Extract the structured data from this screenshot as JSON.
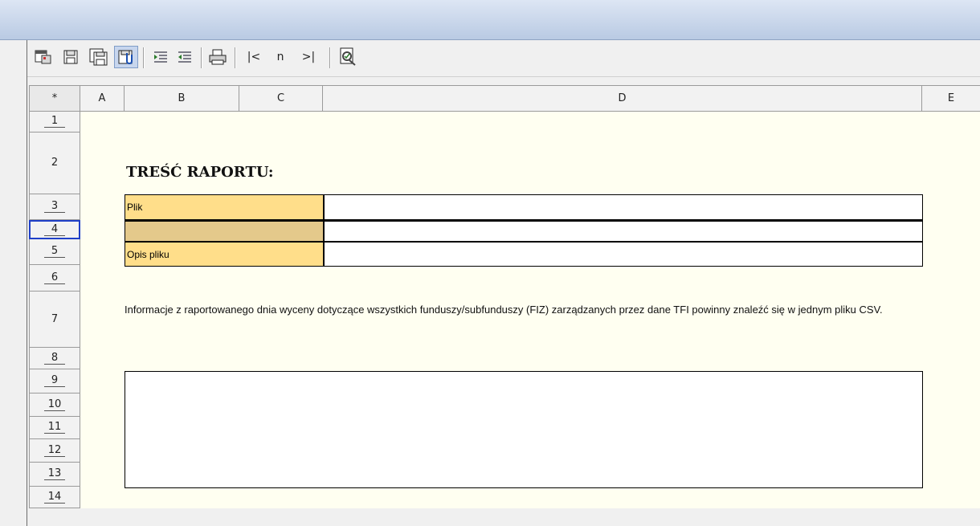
{
  "toolbar": {
    "nav_first": "|<",
    "nav_n": "n",
    "nav_last": ">|"
  },
  "columns": [
    "*",
    "A",
    "B",
    "C",
    "D",
    "E"
  ],
  "rows": [
    "1",
    "2",
    "3",
    "4",
    "5",
    "6",
    "7",
    "8",
    "9",
    "10",
    "11",
    "12",
    "13",
    "14"
  ],
  "form": {
    "title": "TREŚĆ RAPORTU:",
    "plik_label": "Plik",
    "plik_value": "",
    "row4_label": "",
    "row4_value": "",
    "opis_label": "Opis pliku",
    "opis_value": "",
    "info_text": "Informacje z raportowanego dnia wyceny dotyczące wszystkich funduszy/subfunduszy (FIZ) zarządzanych przez dane TFI powinny znaleźć się w jednym pliku CSV.",
    "notes_value": ""
  },
  "colors": {
    "label_fill": "#ffde8a",
    "label_fill_dark": "#e4c98b",
    "sheet_bg": "#fffff1",
    "selected_row": "#1f3fc8"
  }
}
